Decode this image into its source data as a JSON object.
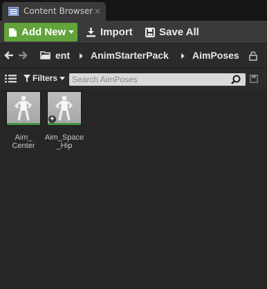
{
  "tab": {
    "title": "Content Browser",
    "close_glyph": "×",
    "icon": "content-browser-icon"
  },
  "toolbar": {
    "add_new_label": "Add New",
    "import_label": "Import",
    "save_all_label": "Save All",
    "add_new_color": "#62a43a"
  },
  "path": {
    "root_label": "ent",
    "crumbs": [
      "AnimStarterPack",
      "AimPoses"
    ]
  },
  "filter": {
    "filters_label": "Filters",
    "search_placeholder": "Search AimPoses"
  },
  "assets": [
    {
      "name": "Aim_\nCenter",
      "type_color": "#3f8f3f",
      "has_star": false
    },
    {
      "name": "Aim_Space\n_Hip",
      "type_color": "#3f8f3f",
      "has_star": true,
      "star_glyph": "✦"
    }
  ]
}
